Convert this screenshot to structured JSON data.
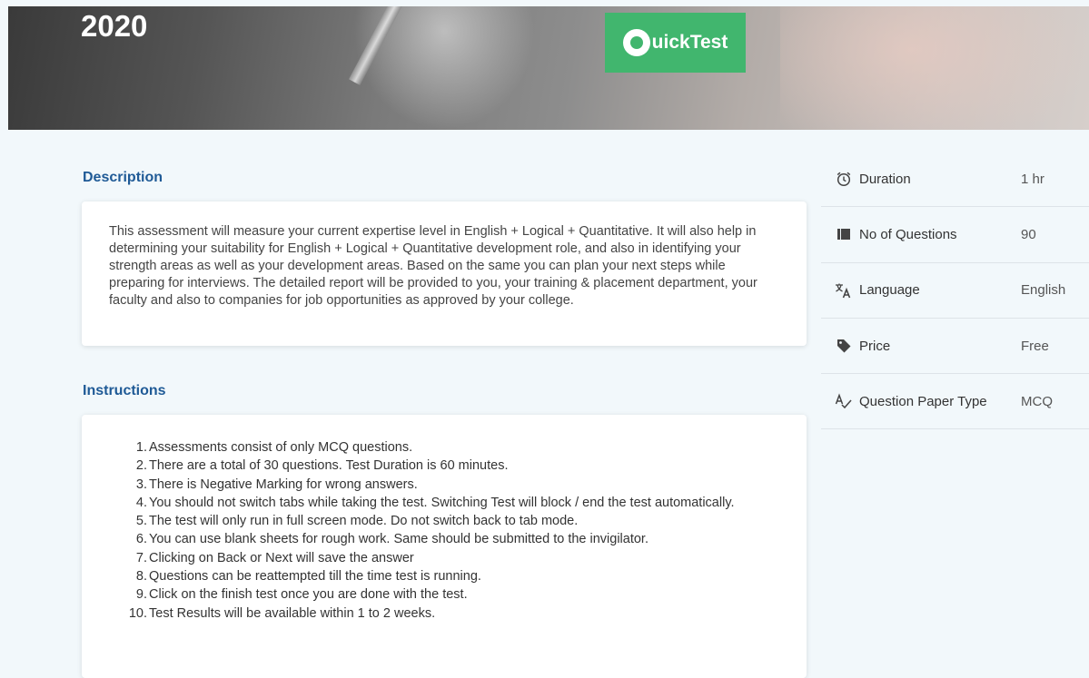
{
  "header": {
    "year": "2020",
    "logo_text": "uickTest"
  },
  "description": {
    "title": "Description",
    "text": "This assessment will measure your current expertise level in English + Logical + Quantitative. It will also help in determining your suitability for English + Logical + Quantitative development role, and also in identifying your strength areas as well as your development areas. Based on the same you can plan your next steps while preparing for interviews. The detailed report will be provided to you, your training & placement department, your faculty and also to companies for job opportunities as approved by your college."
  },
  "instructions": {
    "title": "Instructions",
    "items": [
      {
        "num": "1.",
        "text": "Assessments consist of only MCQ questions."
      },
      {
        "num": "2.",
        "text": "There are a total of 30 questions. Test Duration is 60 minutes."
      },
      {
        "num": "3.",
        "text": "There is Negative Marking for wrong answers."
      },
      {
        "num": "4.",
        "text": "You should not switch tabs while taking the test. Switching Test will block / end the test automatically."
      },
      {
        "num": "5.",
        "text": "The test will only run in full screen mode. Do not switch back to tab mode."
      },
      {
        "num": "6.",
        "text": "You can use blank sheets for rough work. Same should be submitted to the invigilator."
      },
      {
        "num": "7.",
        "text": "Clicking on Back or Next will save the answer"
      },
      {
        "num": "8.",
        "text": "Questions can be reattempted till the time test is running."
      },
      {
        "num": "9.",
        "text": "Click on the finish test once you are done with the test."
      },
      {
        "num": "10.",
        "text": "Test Results will be available within 1 to 2 weeks."
      }
    ]
  },
  "meta": [
    {
      "icon": "alarm-clock-icon",
      "label": "Duration",
      "value": "1 hr"
    },
    {
      "icon": "list-icon",
      "label": "No of Questions",
      "value": "90"
    },
    {
      "icon": "translate-icon",
      "label": "Language",
      "value": "English"
    },
    {
      "icon": "price-tag-icon",
      "label": "Price",
      "value": "Free"
    },
    {
      "icon": "spellcheck-icon",
      "label": "Question Paper Type",
      "value": "MCQ"
    }
  ],
  "colors": {
    "accent": "#1f5a96",
    "logo_bg": "#41b66e",
    "page_bg": "#f2f8fb"
  }
}
